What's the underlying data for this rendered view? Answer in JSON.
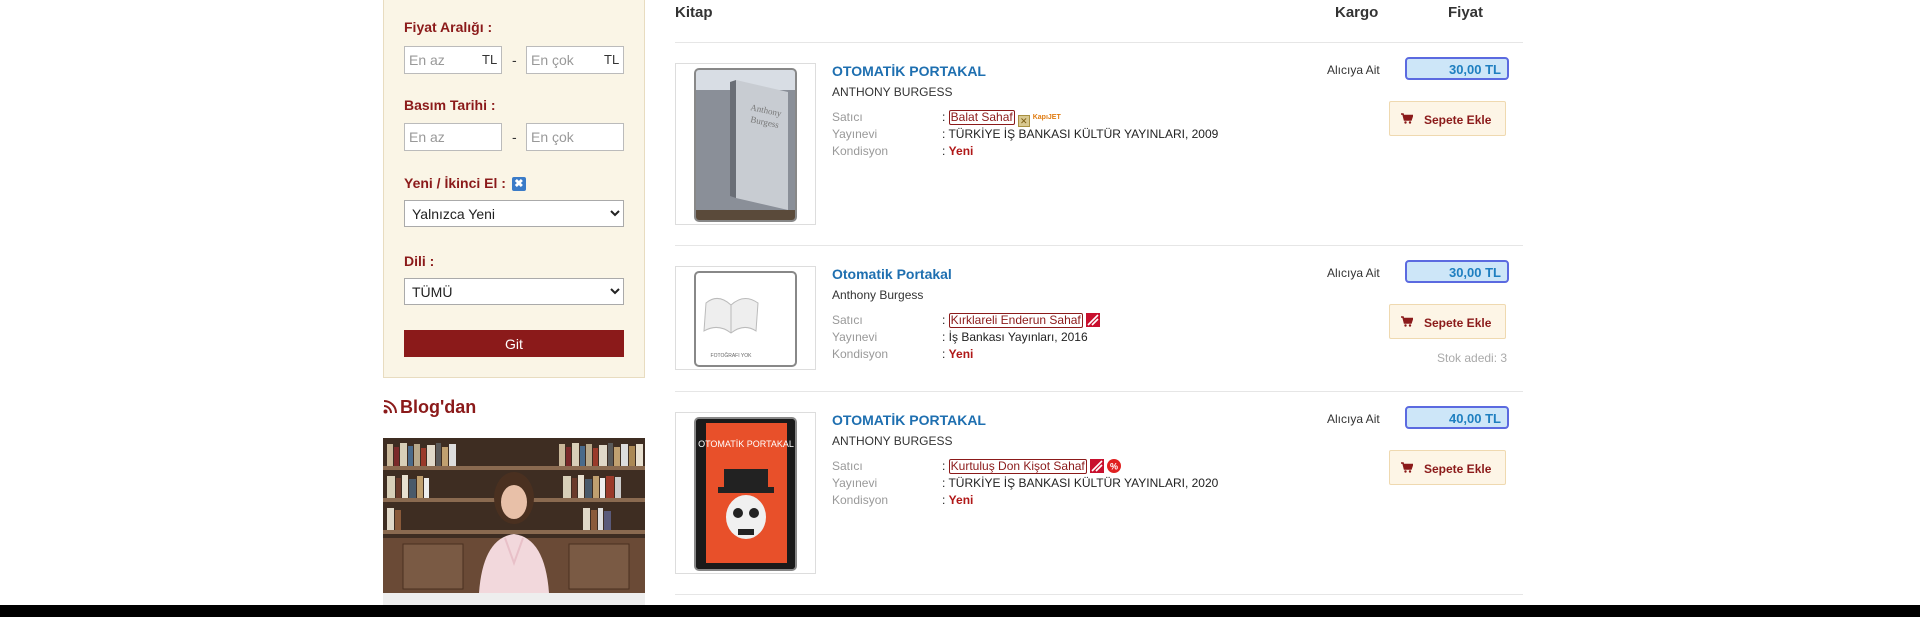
{
  "filters": {
    "price_label": "Fiyat Aralığı :",
    "price_min_placeholder": "En az",
    "price_max_placeholder": "En çok",
    "currency_suffix": "TL",
    "dash": "-",
    "date_label": "Basım Tarihi :",
    "date_min_placeholder": "En az",
    "date_max_placeholder": "En çok",
    "condition_label": "Yeni / İkinci El :",
    "condition_selected": "Yalnızca Yeni",
    "language_label": "Dili :",
    "language_selected": "TÜMÜ",
    "go_label": "Git"
  },
  "blog": {
    "title": "Blog'dan"
  },
  "columns": {
    "book": "Kitap",
    "cargo": "Kargo",
    "price": "Fiyat"
  },
  "labels": {
    "seller": "Satıcı",
    "publisher": "Yayınevi",
    "condition": "Kondisyon"
  },
  "products": [
    {
      "title": "OTOMATİK PORTAKAL",
      "author": "ANTHONY BURGESS",
      "seller": "Balat Sahaf",
      "publisher": "TÜRKİYE İŞ BANKASI KÜLTÜR YAYINLARI, 2009",
      "condition": "Yeni",
      "cargo": "Alıcıya Ait",
      "price": "30,00 TL",
      "cart_label": "Sepete Ekle",
      "badge_text": "KapıJET"
    },
    {
      "title": "Otomatik Portakal",
      "author": "Anthony Burgess",
      "seller": "Kırklareli Enderun Sahaf",
      "publisher": "İş Bankası Yayınları, 2016",
      "condition": "Yeni",
      "cargo": "Alıcıya Ait",
      "price": "30,00 TL",
      "cart_label": "Sepete Ekle",
      "stock": "Stok adedi: 3",
      "no_photo_text": "FOTOĞRAFI YOK"
    },
    {
      "title": "OTOMATİK PORTAKAL",
      "author": "ANTHONY BURGESS",
      "seller": "Kurtuluş Don Kişot Sahaf",
      "publisher": "TÜRKİYE İŞ BANKASI KÜLTÜR YAYINLARI, 2020",
      "condition": "Yeni",
      "cargo": "Alıcıya Ait",
      "price": "40,00 TL",
      "cart_label": "Sepete Ekle",
      "cover_text": "OTOMATİK PORTAKAL"
    }
  ],
  "colors": {
    "brand": "#8b1a1a",
    "link": "#1e6fb0",
    "price_bg": "#cde6f8",
    "sidebar_bg": "#faf5e6"
  }
}
